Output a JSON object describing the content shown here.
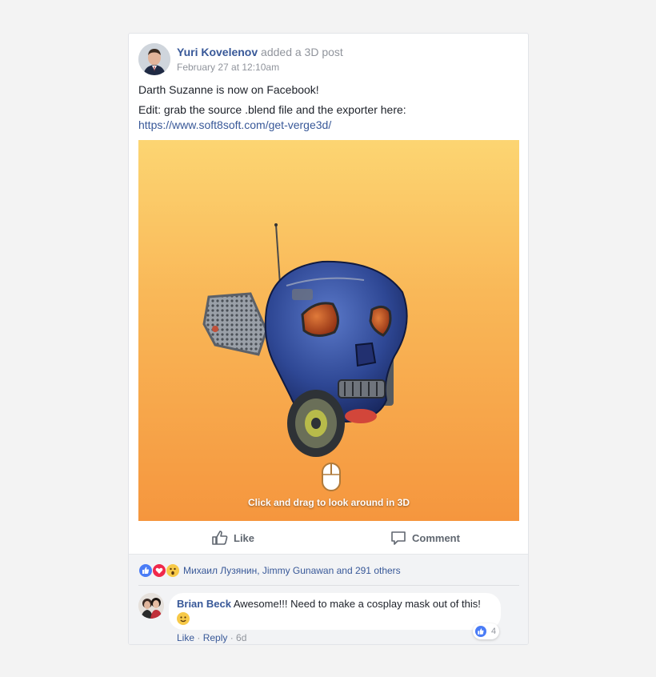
{
  "post": {
    "author": "Yuri Kovelenov",
    "action": "added a 3D post",
    "timestamp": "February 27 at 12:10am",
    "text_line1": "Darth Suzanne is now on Facebook!",
    "text_line2": "Edit: grab the source .blend file and the exporter here:",
    "link": "https://www.soft8soft.com/get-verge3d/",
    "media_hint": "Click and drag to look around in 3D"
  },
  "actions": {
    "like_label": "Like",
    "comment_label": "Comment"
  },
  "reactions": {
    "icons": [
      "like-icon",
      "love-icon",
      "wow-icon"
    ],
    "names": "Михаил Лузянин, Jimmy Gunawan and 291 others"
  },
  "comment": {
    "author": "Brian Beck",
    "text": "Awesome!!! Need to make a cosplay mask out of this!",
    "emoji": "slightly-smiling-face",
    "like_count": "4",
    "like_link": "Like",
    "reply_link": "Reply",
    "separator": " · ",
    "time": "6d"
  },
  "colors": {
    "link": "#385898",
    "muted": "#90949c",
    "like_blue": "#4a7cf6",
    "love_red": "#f0284a",
    "wow_yellow": "#f7c948",
    "gradient_top": "#fcd572",
    "gradient_bottom": "#f5963e"
  }
}
